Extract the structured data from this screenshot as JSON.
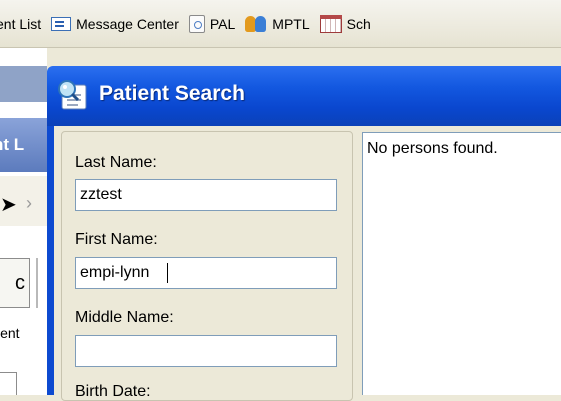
{
  "toolbar": {
    "items": [
      {
        "label": "ent List",
        "icon": "none"
      },
      {
        "label": "Message Center",
        "icon": "message-center-icon"
      },
      {
        "label": "PAL",
        "icon": "pal-icon"
      },
      {
        "label": "MPTL",
        "icon": "mptl-people-icon"
      },
      {
        "label": "Sch",
        "icon": "schedule-calendar-icon"
      }
    ]
  },
  "background": {
    "title_fragment": "nt L",
    "tab_fragment": "c",
    "label_fragment": "ient"
  },
  "dialog": {
    "title": "Patient Search",
    "last_name_label": "Last Name:",
    "last_name_value": "zztest",
    "first_name_label": "First Name:",
    "first_name_value": "empi-lynn",
    "middle_name_label": "Middle Name:",
    "middle_name_value": "",
    "birth_date_label": "Birth Date:",
    "results_message": "No persons found."
  },
  "colors": {
    "titlebar": "#0a47cf",
    "window_bg": "#ece9d8",
    "input_border": "#7f9db9"
  }
}
